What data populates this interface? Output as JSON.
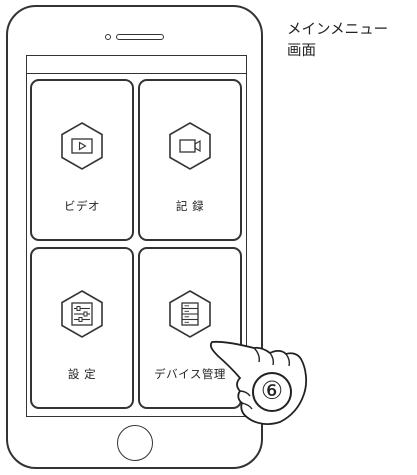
{
  "caption": {
    "line1": "メインメニュー",
    "line2": "画面"
  },
  "menu": {
    "items": [
      {
        "label": "ビデオ",
        "icon": "play-video-icon"
      },
      {
        "label": "記 録",
        "icon": "camera-record-icon"
      },
      {
        "label": "設 定",
        "icon": "sliders-settings-icon"
      },
      {
        "label": "デバイス管理",
        "icon": "server-device-icon"
      }
    ]
  },
  "step": {
    "number": "⑥"
  },
  "colors": {
    "outline": "#333333",
    "background": "#ffffff"
  }
}
